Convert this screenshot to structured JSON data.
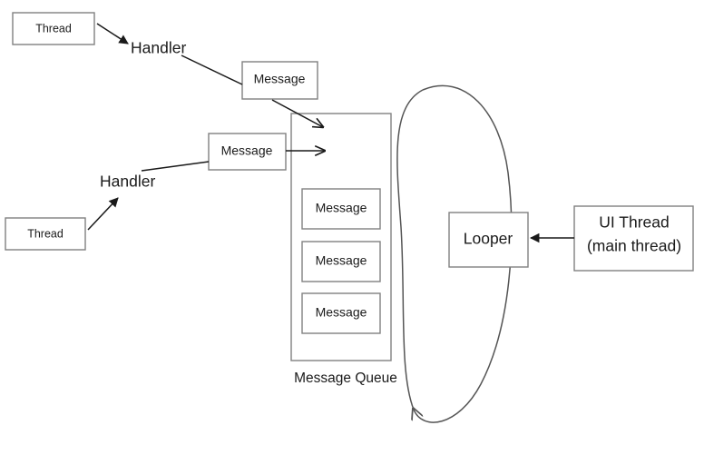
{
  "diagram": {
    "title": "Android Handler / Looper / MessageQueue diagram",
    "background_color": "#ffffff",
    "box_stroke_color": "#808080",
    "arrow_color": "#1a1a1a",
    "loop_color": "#555555",
    "text_color": "#1a1a1a"
  },
  "nodes": {
    "thread_top": {
      "label": "Thread"
    },
    "thread_bottom": {
      "label": "Thread"
    },
    "handler_top": {
      "label": "Handler"
    },
    "handler_bottom": {
      "label": "Handler"
    },
    "message_top": {
      "label": "Message"
    },
    "message_middle": {
      "label": "Message"
    },
    "looper": {
      "label": "Looper"
    },
    "ui_thread": {
      "line1": "UI Thread",
      "line2": "(main thread)"
    }
  },
  "message_queue": {
    "caption": "Message Queue",
    "messages": [
      {
        "label": "Message"
      },
      {
        "label": "Message"
      },
      {
        "label": "Message"
      }
    ]
  },
  "connections": [
    {
      "from": "thread_top",
      "to": "handler_top",
      "arrowhead": true
    },
    {
      "from": "handler_top",
      "to": "message_top",
      "arrowhead": false
    },
    {
      "from": "message_top",
      "to": "message_queue",
      "arrowhead": true
    },
    {
      "from": "thread_bottom",
      "to": "handler_bottom",
      "arrowhead": true
    },
    {
      "from": "handler_bottom",
      "to": "message_middle",
      "arrowhead": false
    },
    {
      "from": "message_middle",
      "to": "message_queue",
      "arrowhead": true
    },
    {
      "from": "ui_thread",
      "to": "looper",
      "arrowhead": true
    },
    {
      "from": "looper",
      "to": "message_queue",
      "arrowhead": true,
      "style": "loop-ellipse"
    }
  ]
}
